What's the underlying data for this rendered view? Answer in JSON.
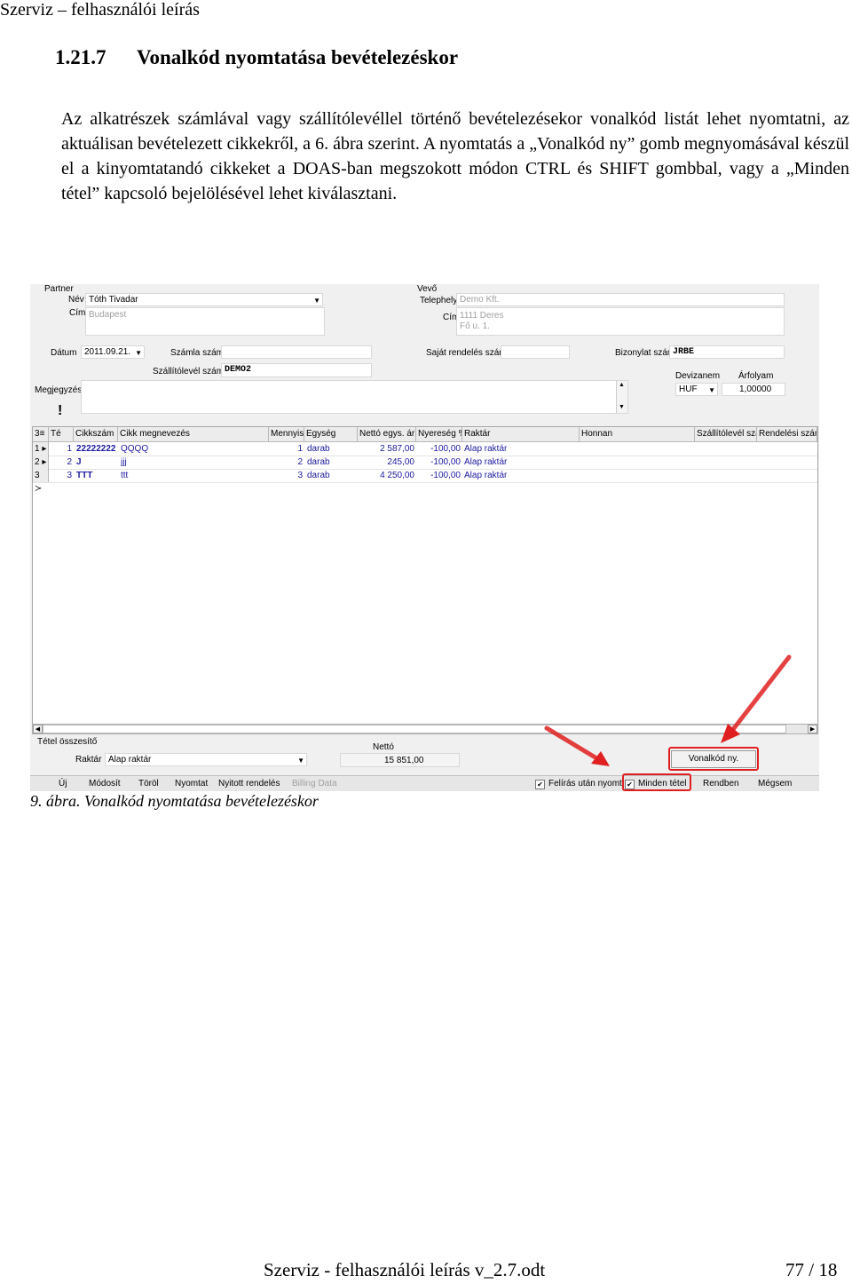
{
  "page": {
    "header": "Szerviz – felhasználói leírás",
    "section_number": "1.21.7",
    "section_title": "Vonalkód nyomtatása bevételezéskor",
    "paragraph": "Az alkatrészek számlával vagy szállítólevéllel történő bevételezésekor vonalkód listát lehet nyomtatni, az aktuálisan bevételezett cikkekről, a 6. ábra szerint. A nyomtatás a „Vonalkód ny” gomb megnyomásával készül el a kinyomtatandó cikkeket a DOAS-ban megszokott módon CTRL és SHIFT gombbal, vagy a „Minden tétel” kapcsoló bejelölésével lehet kiválasztani.",
    "caption": "9. ábra. Vonalkód nyomtatása bevételezéskor",
    "footer": "Szerviz - felhasználói leírás v_2.7.odt",
    "page_number": "77 / 18"
  },
  "screenshot": {
    "partner": {
      "group": "Partner",
      "name_label": "Név",
      "name_value": "Tóth Tivadar",
      "address_label": "Cím",
      "address_value": "Budapest"
    },
    "buyer": {
      "group": "Vevő",
      "site_label": "Telephely",
      "site_value": "Demo Kft.",
      "address_label": "Cím",
      "address_line1": "1111 Deres",
      "address_line2": "Fő u. 1."
    },
    "date_label": "Dátum",
    "date_value": "2011.09.21.",
    "invoice_label": "Számla szám",
    "invoice_value": "",
    "own_order_label": "Saját rendelés szám",
    "receipt_label": "Bizonylat szám",
    "receipt_value": "JRBE",
    "delivery_note_label": "Szállítólevél szám",
    "delivery_note_value": "DEMO2",
    "currency_label": "Devizanem",
    "currency_value": "HUF",
    "rate_label": "Árfolyam",
    "rate_value": "1,00000",
    "note_label": "Megjegyzés",
    "warning_mark": "!",
    "grid": {
      "corner": "3",
      "columns": [
        "Té",
        "Cikkszám",
        "Cikk megnevezés",
        "Mennyis",
        "Egység",
        "Nettó egys. ár",
        "Nyereség %",
        "Raktár",
        "Honnan",
        "Szállítólevél szá",
        "Rendelési szám"
      ],
      "rows": [
        {
          "ind": "1",
          "te": "1",
          "code": "22222222",
          "name": "QQQQ",
          "qty": "1",
          "unit": "darab",
          "price": "2 587,00",
          "profit": "-100,00",
          "store": "Alap raktár"
        },
        {
          "ind": "2",
          "te": "2",
          "code": "J",
          "name": "jjj",
          "qty": "2",
          "unit": "darab",
          "price": "245,00",
          "profit": "-100,00",
          "store": "Alap raktár"
        },
        {
          "ind": "3",
          "te": "3",
          "code": "TTT",
          "name": "ttt",
          "qty": "3",
          "unit": "darab",
          "price": "4 250,00",
          "profit": "-100,00",
          "store": "Alap raktár"
        }
      ]
    },
    "summary": {
      "group": "Tétel összesítő",
      "store_label": "Raktár",
      "store_value": "Alap raktár",
      "net_label": "Nettó",
      "net_value": "15 851,00"
    },
    "barcode_button": "Vonalkód ny.",
    "toolbar": {
      "new": "Új",
      "modify": "Módosít",
      "delete": "Töröl",
      "print": "Nyomtat",
      "open_orders": "Nyitott rendelés",
      "billing": "Billing Data",
      "print_after": "Felírás után nyomt",
      "all_items": "Minden tétel",
      "ok": "Rendben",
      "cancel": "Mégsem"
    },
    "colors": {
      "accent_red": "#e02020",
      "row_text": "#1a1aa0"
    }
  }
}
